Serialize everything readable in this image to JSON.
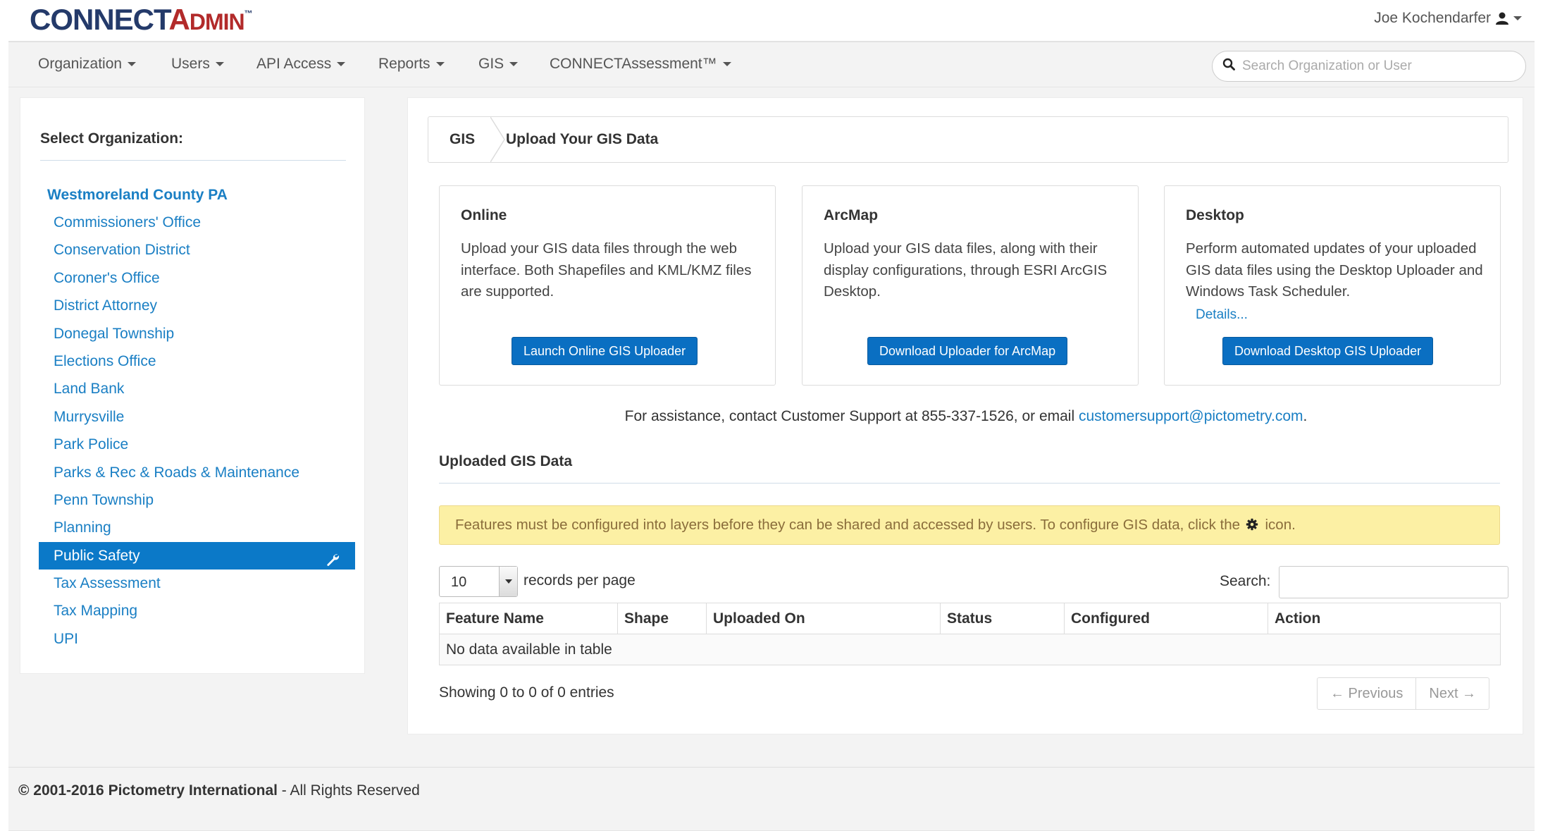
{
  "header": {
    "logo_connect": "CONNECT",
    "logo_a1": "A",
    "logo_dmin": "DMIN",
    "logo_tm": "™",
    "user_name": "Joe Kochendarfer",
    "user_icon": "user-icon"
  },
  "nav": {
    "items": [
      {
        "label": "Organization"
      },
      {
        "label": "Users"
      },
      {
        "label": "API Access"
      },
      {
        "label": "Reports"
      },
      {
        "label": "GIS"
      },
      {
        "label": "CONNECTAssessment™"
      }
    ],
    "search_placeholder": "Search Organization or User"
  },
  "sidebar": {
    "title": "Select Organization:",
    "root_org": "Westmoreland County PA",
    "items": [
      {
        "label": "Commissioners' Office"
      },
      {
        "label": "Conservation District"
      },
      {
        "label": "Coroner's Office"
      },
      {
        "label": "District Attorney"
      },
      {
        "label": "Donegal Township"
      },
      {
        "label": "Elections Office"
      },
      {
        "label": "Land Bank"
      },
      {
        "label": "Murrysville"
      },
      {
        "label": "Park Police"
      },
      {
        "label": "Parks & Rec & Roads & Maintenance"
      },
      {
        "label": "Penn Township"
      },
      {
        "label": "Planning"
      },
      {
        "label": "Public Safety",
        "active": true
      },
      {
        "label": "Tax Assessment"
      },
      {
        "label": "Tax Mapping"
      },
      {
        "label": "UPI"
      }
    ]
  },
  "breadcrumb": {
    "root": "GIS",
    "current": "Upload Your GIS Data"
  },
  "cards": [
    {
      "title": "Online",
      "text": "Upload your GIS data files through the web interface. Both Shapefiles and KML/KMZ files are supported.",
      "button": "Launch Online GIS Uploader"
    },
    {
      "title": "ArcMap",
      "text": "Upload your GIS data files, along with their display configurations, through ESRI ArcGIS Desktop.",
      "button": "Download Uploader for ArcMap"
    },
    {
      "title": "Desktop",
      "text": "Perform automated updates of your uploaded GIS data files using the Desktop Uploader and Windows Task Scheduler.",
      "link": "Details...",
      "button": "Download Desktop GIS Uploader"
    }
  ],
  "assist": {
    "text": "For assistance, contact Customer Support at 855-337-1526, or email ",
    "email": "customersupport@pictometry.com",
    "end": "."
  },
  "uploaded": {
    "title": "Uploaded GIS Data",
    "alert_before": "Features must be configured into layers before they can be shared and accessed by users. To configure GIS data, click the",
    "alert_after": "icon.",
    "alert_icon": "gear-icon",
    "page_length": "10",
    "page_length_label": "records per page",
    "search_label": "Search:",
    "search_value": "",
    "columns": [
      "Feature Name",
      "Shape",
      "Uploaded On",
      "Status",
      "Configured",
      "Action"
    ],
    "empty_message": "No data available in table",
    "info": "Showing 0 to 0 of 0 entries",
    "prev": "← Previous",
    "next": "Next →"
  },
  "footer": {
    "copyright": "© 2001-2016 Pictometry International",
    "rest": " - All Rights Reserved"
  },
  "colors": {
    "brand_blue": "#243a6a",
    "brand_red": "#b22a2a",
    "link": "#1a7fc4",
    "active_bg": "#0b79c8",
    "button_bg": "#0a6fc2",
    "alert_bg": "#fcf0a4",
    "alert_text": "#8a6d3b"
  }
}
